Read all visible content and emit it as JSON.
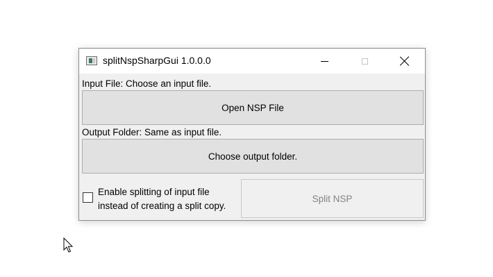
{
  "window": {
    "title": "splitNspSharpGui 1.0.0.0",
    "app_icon": "window-app-icon",
    "controls": {
      "minimize_icon": "minimize-icon",
      "maximize_icon": "maximize-icon",
      "maximize_enabled": false,
      "close_icon": "close-icon"
    }
  },
  "input": {
    "label": "Input File: Choose an input file.",
    "button_label": "Open NSP File"
  },
  "output": {
    "label": "Output Folder: Same as input file.",
    "button_label": "Choose output folder."
  },
  "options": {
    "inplace_checkbox_checked": false,
    "inplace_line1": "Enable splitting of input file",
    "inplace_line2": "instead of creating a split copy."
  },
  "actions": {
    "split_label": "Split NSP",
    "split_enabled": false
  },
  "colors": {
    "button_bg": "#e1e1e1",
    "button_border": "#adadad",
    "disabled_text": "#838383",
    "window_bg": "#f0f0f0"
  },
  "cursor_icon": "mouse-pointer-icon"
}
